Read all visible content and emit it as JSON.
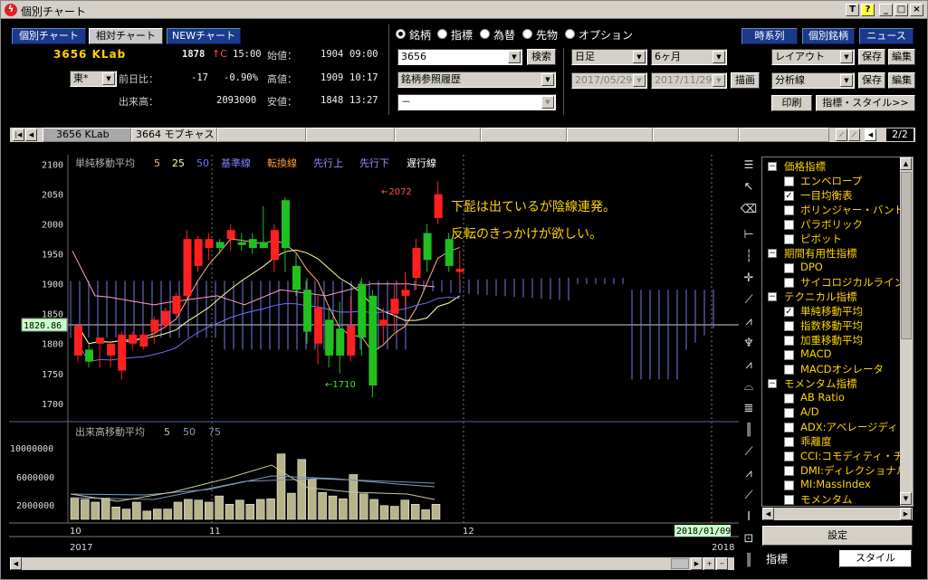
{
  "window": {
    "title": "個別チャート",
    "controls": [
      "T",
      "?",
      "_",
      "□",
      "×"
    ]
  },
  "nav_buttons": {
    "individual": "個別チャート",
    "relative": "相対チャート",
    "new": "NEWチャート"
  },
  "top_right_buttons": {
    "timeseries": "時系列",
    "stock": "個別銘柄",
    "news": "ニュース"
  },
  "stock": {
    "code_name": "3656 KLab",
    "price": "1878",
    "change_mark": "↑C",
    "price_time": "15:00",
    "exchange": "東*",
    "prev_label": "前日比：",
    "prev_change": "-17",
    "prev_pct": "-0.90%",
    "volume_label": "出来高：",
    "volume": "2093000",
    "open_label": "始値：",
    "open": "1904",
    "open_time": "09:00",
    "high_label": "高値：",
    "high": "1909",
    "high_time": "10:17",
    "low_label": "安値：",
    "low": "1848",
    "low_time": "13:27"
  },
  "radio": {
    "options": [
      "銘柄",
      "指標",
      "為替",
      "先物",
      "オプション"
    ],
    "selected": 0
  },
  "search": {
    "code": "3656",
    "search_button": "検索",
    "history": "銘柄参照履歴",
    "blank": "－"
  },
  "period": {
    "unit": "日足",
    "range": "6ヶ月",
    "from": "2017/05/29",
    "to": "2017/11/29",
    "draw": "描画"
  },
  "layout": {
    "layout_label": "レイアウト",
    "save": "保存",
    "edit": "編集",
    "analysis": "分析線",
    "print": "印刷",
    "style": "指標・スタイル>>"
  },
  "tabs": {
    "items": [
      "3656 KLab",
      "3664 モブキャス"
    ],
    "page": "2/2"
  },
  "chart": {
    "legend": [
      "単純移動平均",
      "5",
      "25",
      "50",
      "基準線",
      "転換線",
      "先行上",
      "先行下",
      "遅行線"
    ],
    "legend_colors": [
      "#b0b0b0",
      "#ffb080",
      "#ffffa0",
      "#7070ff",
      "#8080ff",
      "#ff9a3c",
      "#9090ff",
      "#9090ff",
      "#ffffff"
    ],
    "annotation1": "下髭は出ているが陰線連発。",
    "annotation2": "反転のきっかけが欲しい。",
    "high_label": "←2072",
    "low_label": "←1710",
    "cursor_price": "1820.86",
    "y_ticks": [
      "2100",
      "2050",
      "2000",
      "1950",
      "1900",
      "1850",
      "1800",
      "1750",
      "1700"
    ],
    "vol_legend": [
      "出来高移動平均",
      "5",
      "50",
      "75"
    ],
    "vol_ticks": [
      "10000000",
      "6000000",
      "2000000"
    ],
    "x_labels": [
      "10",
      "11",
      "12"
    ],
    "year_labels": [
      "2017",
      "2018"
    ],
    "date_box": "2018/01/09",
    "colors": {
      "up": "#ff2020",
      "down": "#20c020",
      "cloud": "#7878e8",
      "grid": "#555555"
    }
  },
  "chart_data": {
    "type": "candlestick",
    "ylim": [
      1680,
      2110
    ],
    "candles": [
      [
        1780,
        1830,
        1770,
        1745
      ],
      [
        1790,
        1770,
        1760,
        1800
      ],
      [
        1800,
        1810,
        1760,
        1790
      ],
      [
        1780,
        1800,
        1760,
        1765
      ],
      [
        1755,
        1815,
        1740,
        1820
      ],
      [
        1800,
        1815,
        1790,
        1820
      ],
      [
        1795,
        1815,
        1790,
        1820
      ],
      [
        1820,
        1840,
        1800,
        1845
      ],
      [
        1830,
        1855,
        1825,
        1860
      ],
      [
        1850,
        1880,
        1845,
        1885
      ],
      [
        1880,
        1975,
        1875,
        1990
      ],
      [
        1930,
        1975,
        1920,
        1980
      ],
      [
        1960,
        1975,
        1940,
        1985
      ],
      [
        1970,
        1960,
        1950,
        1975
      ],
      [
        1975,
        1990,
        1955,
        2000
      ],
      [
        1970,
        1965,
        1955,
        1985
      ],
      [
        1975,
        1960,
        1950,
        1985
      ],
      [
        1970,
        1960,
        1960,
        2030
      ],
      [
        1940,
        1990,
        1920,
        2000
      ],
      [
        2040,
        1960,
        1920,
        2045
      ],
      [
        1930,
        1890,
        1880,
        1950
      ],
      [
        1890,
        1820,
        1800,
        1910
      ],
      [
        1800,
        1860,
        1765,
        1880
      ],
      [
        1840,
        1780,
        1760,
        1860
      ],
      [
        1825,
        1780,
        1750,
        1870
      ],
      [
        1780,
        1830,
        1770,
        1880
      ],
      [
        1900,
        1810,
        1780,
        1910
      ],
      [
        1880,
        1730,
        1710,
        1890
      ],
      [
        1830,
        1840,
        1800,
        1860
      ],
      [
        1850,
        1875,
        1820,
        1900
      ],
      [
        1880,
        1890,
        1860,
        1920
      ],
      [
        1910,
        1960,
        1890,
        1975
      ],
      [
        1985,
        1940,
        1920,
        2000
      ],
      [
        2010,
        2050,
        2000,
        2072
      ],
      [
        1975,
        1930,
        1920,
        1985
      ],
      [
        1920,
        1925,
        1900,
        1955
      ]
    ],
    "volume": [
      3.1,
      2.9,
      2.5,
      3.1,
      1.8,
      1.5,
      2.5,
      1.2,
      1.5,
      1.5,
      2.5,
      2.9,
      2.8,
      2.5,
      3.4,
      2.2,
      2.8,
      2.2,
      2.9,
      3.0,
      9.5,
      3.8,
      8.7,
      5.8,
      3.9,
      3.4,
      3.0,
      6.5,
      3.7,
      2.9,
      2.0,
      1.9,
      2.8,
      2.2,
      1.4,
      2.2,
      2.7,
      1.4,
      2.1,
      1.1,
      1.2,
      4.4
    ]
  },
  "tree": {
    "items": [
      {
        "label": "価格指標",
        "level": 0
      },
      {
        "label": "エンベロープ",
        "level": 1,
        "checked": false
      },
      {
        "label": "一目均衡表",
        "level": 1,
        "checked": true
      },
      {
        "label": "ボリンジャー・バンド",
        "level": 1,
        "checked": false
      },
      {
        "label": "パラボリック",
        "level": 1,
        "checked": false
      },
      {
        "label": "ピボット",
        "level": 1,
        "checked": false
      },
      {
        "label": "期間有用性指標",
        "level": 0
      },
      {
        "label": "DPO",
        "level": 1,
        "checked": false
      },
      {
        "label": "サイコロジカルライン",
        "level": 1,
        "checked": false
      },
      {
        "label": "テクニカル指標",
        "level": 0
      },
      {
        "label": "単純移動平均",
        "level": 1,
        "checked": true
      },
      {
        "label": "指数移動平均",
        "level": 1,
        "checked": false
      },
      {
        "label": "加重移動平均",
        "level": 1,
        "checked": false
      },
      {
        "label": "MACD",
        "level": 1,
        "checked": false
      },
      {
        "label": "MACDオシレータ",
        "level": 1,
        "checked": false
      },
      {
        "label": "モメンタム指標",
        "level": 0
      },
      {
        "label": "AB Ratio",
        "level": 1,
        "checked": false
      },
      {
        "label": "A/D",
        "level": 1,
        "checked": false
      },
      {
        "label": "ADX:アベレージディレ",
        "level": 1,
        "checked": false
      },
      {
        "label": "乖離度",
        "level": 1,
        "checked": false
      },
      {
        "label": "CCI:コモディティ・チャ",
        "level": 1,
        "checked": false
      },
      {
        "label": "DMI:ディレクショナル",
        "level": 1,
        "checked": false
      },
      {
        "label": "MI:MassIndex",
        "level": 1,
        "checked": false
      },
      {
        "label": "モメンタム",
        "level": 1,
        "checked": false
      }
    ],
    "settings_button": "設定",
    "tab_indicator": "指標",
    "tab_style": "スタイル"
  }
}
